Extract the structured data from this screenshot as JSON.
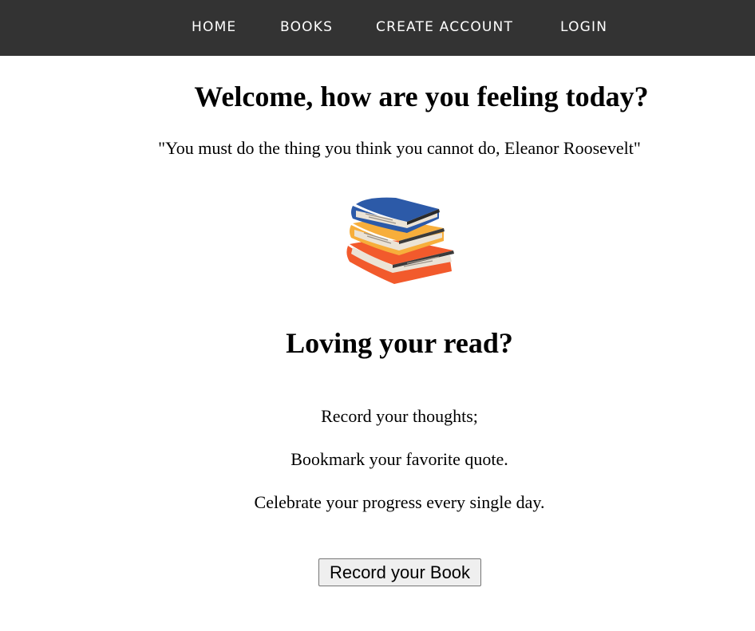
{
  "nav": {
    "items": [
      {
        "label": "HOME"
      },
      {
        "label": "BOOKS"
      },
      {
        "label": "CREATE ACCOUNT"
      },
      {
        "label": "LOGIN"
      }
    ]
  },
  "hero": {
    "heading": "Welcome, how are you feeling today?",
    "quote": "\"You must do the thing you think you cannot do, Eleanor Roosevelt\"",
    "illustration_icon": "stack-of-books-icon"
  },
  "promo": {
    "heading": "Loving your read?",
    "lines": [
      "Record your thoughts;",
      "Bookmark your favorite quote.",
      "Celebrate your progress every single day."
    ],
    "button_label": "Record your Book"
  },
  "colors": {
    "navbar_bg": "#333333",
    "nav_text": "#ffffff",
    "book_blue": "#2c5aa8",
    "book_yellow": "#f7ae3b",
    "book_red": "#f25a2c",
    "page_cream": "#ebe3d6"
  }
}
